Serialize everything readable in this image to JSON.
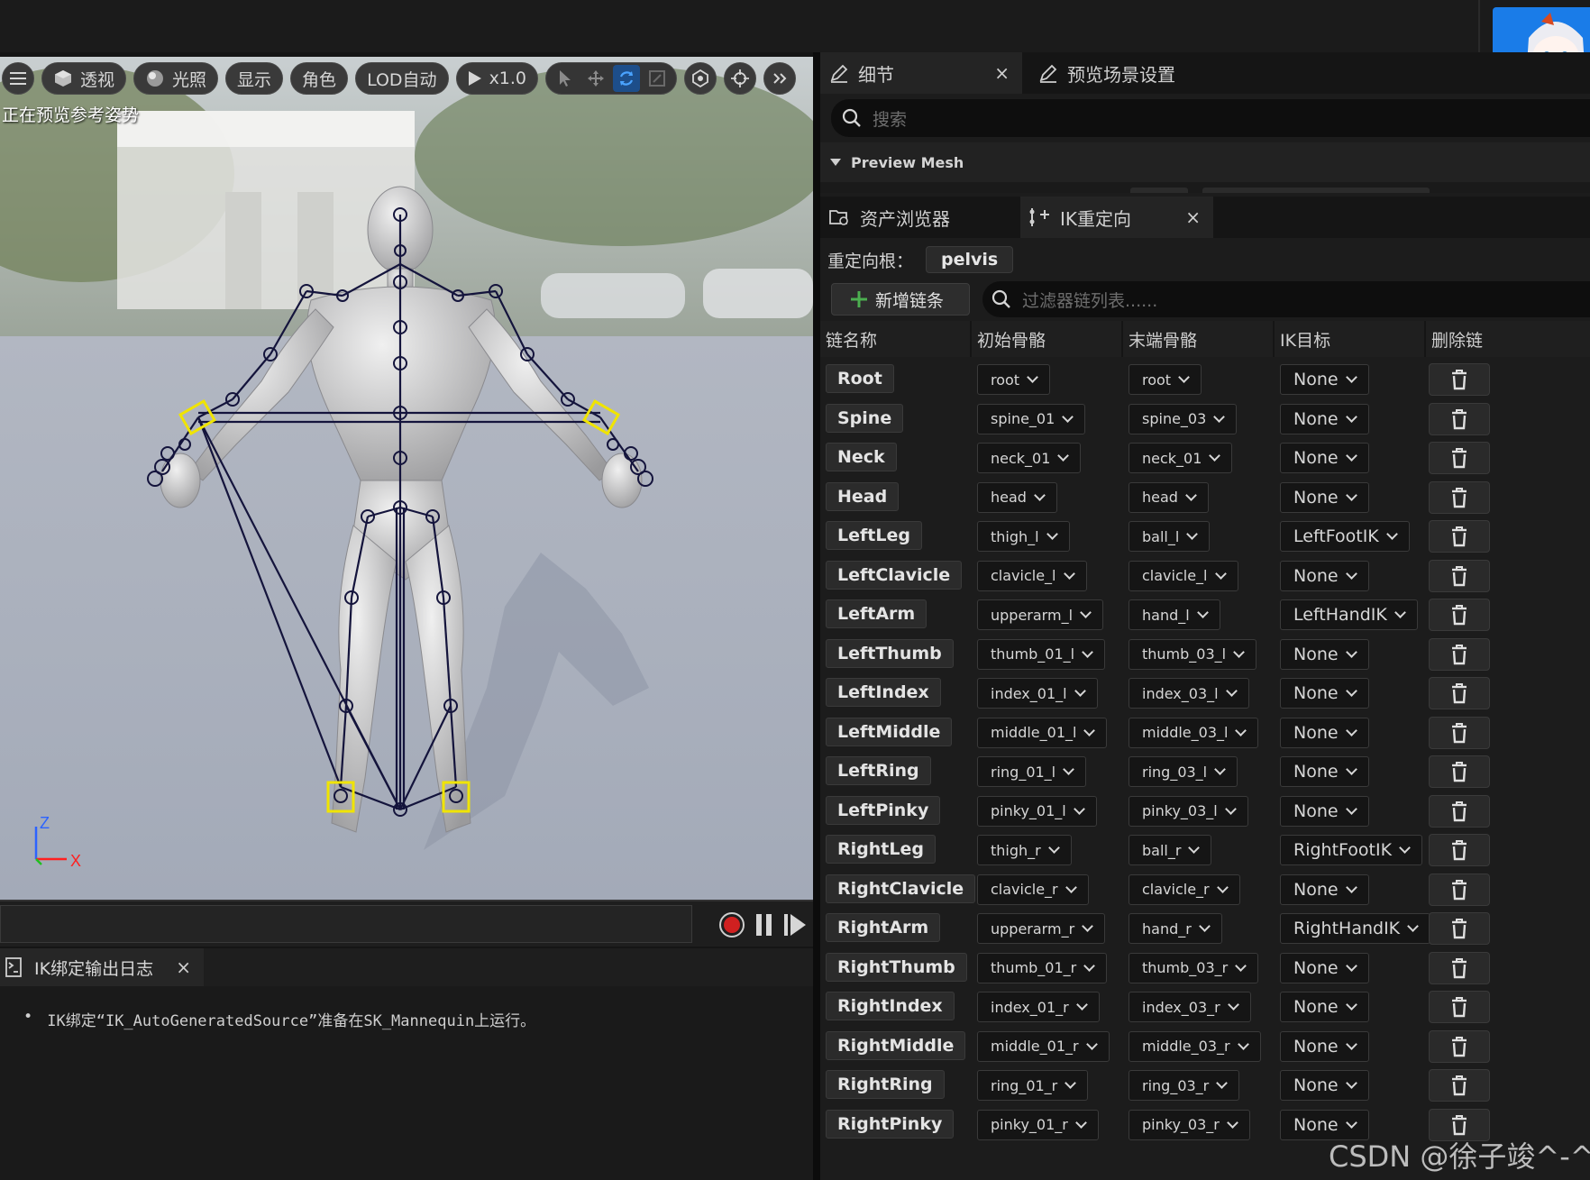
{
  "viewport": {
    "toolbar": {
      "perspective": "透视",
      "lighting": "光照",
      "show": "显示",
      "character": "角色",
      "lod": "LOD自动",
      "speed": "x1.0"
    },
    "status": "正在预览参考姿势",
    "axis": {
      "z": "Z",
      "x": "X"
    }
  },
  "log": {
    "tab_label": "IK绑定输出日志",
    "message": "IK绑定“IK_AutoGeneratedSource”准备在SK_Mannequin上运行。"
  },
  "details": {
    "tab_details": "细节",
    "tab_preview_settings": "预览场景设置",
    "search_placeholder": "搜索",
    "section_preview_mesh": "Preview Mesh"
  },
  "retarget": {
    "tab_asset_browser": "资产浏览器",
    "tab_ik_retarget": "IK重定向",
    "root_label": "重定向根：",
    "root_value": "pelvis",
    "add_chain": "新增链条",
    "filter_placeholder": "过滤器链列表......",
    "columns": {
      "name": "链名称",
      "start": "初始骨骼",
      "end": "末端骨骼",
      "ik": "IK目标",
      "delete": "删除链"
    },
    "chains": [
      {
        "name": "Root",
        "start": "root",
        "end": "root",
        "ik": "None"
      },
      {
        "name": "Spine",
        "start": "spine_01",
        "end": "spine_03",
        "ik": "None"
      },
      {
        "name": "Neck",
        "start": "neck_01",
        "end": "neck_01",
        "ik": "None"
      },
      {
        "name": "Head",
        "start": "head",
        "end": "head",
        "ik": "None"
      },
      {
        "name": "LeftLeg",
        "start": "thigh_l",
        "end": "ball_l",
        "ik": "LeftFootIK"
      },
      {
        "name": "LeftClavicle",
        "start": "clavicle_l",
        "end": "clavicle_l",
        "ik": "None"
      },
      {
        "name": "LeftArm",
        "start": "upperarm_l",
        "end": "hand_l",
        "ik": "LeftHandIK"
      },
      {
        "name": "LeftThumb",
        "start": "thumb_01_l",
        "end": "thumb_03_l",
        "ik": "None"
      },
      {
        "name": "LeftIndex",
        "start": "index_01_l",
        "end": "index_03_l",
        "ik": "None"
      },
      {
        "name": "LeftMiddle",
        "start": "middle_01_l",
        "end": "middle_03_l",
        "ik": "None"
      },
      {
        "name": "LeftRing",
        "start": "ring_01_l",
        "end": "ring_03_l",
        "ik": "None"
      },
      {
        "name": "LeftPinky",
        "start": "pinky_01_l",
        "end": "pinky_03_l",
        "ik": "None"
      },
      {
        "name": "RightLeg",
        "start": "thigh_r",
        "end": "ball_r",
        "ik": "RightFootIK"
      },
      {
        "name": "RightClavicle",
        "start": "clavicle_r",
        "end": "clavicle_r",
        "ik": "None"
      },
      {
        "name": "RightArm",
        "start": "upperarm_r",
        "end": "hand_r",
        "ik": "RightHandIK"
      },
      {
        "name": "RightThumb",
        "start": "thumb_01_r",
        "end": "thumb_03_r",
        "ik": "None"
      },
      {
        "name": "RightIndex",
        "start": "index_01_r",
        "end": "index_03_r",
        "ik": "None"
      },
      {
        "name": "RightMiddle",
        "start": "middle_01_r",
        "end": "middle_03_r",
        "ik": "None"
      },
      {
        "name": "RightRing",
        "start": "ring_01_r",
        "end": "ring_03_r",
        "ik": "None"
      },
      {
        "name": "RightPinky",
        "start": "pinky_01_r",
        "end": "pinky_03_r",
        "ik": "None"
      }
    ]
  },
  "watermark": "CSDN @徐子竣^-^",
  "colors": {
    "accent_blue": "#1a7ce8",
    "add_green": "#4caf50",
    "record_red": "#d02020",
    "bone_navy": "#14143c",
    "ik_goal_yellow": "#f0e400"
  },
  "icons": {
    "menu": "menu-icon",
    "perspective": "cube-icon",
    "lighting": "sphere-icon",
    "play": "play-icon",
    "details": "pencil-icon",
    "search": "search-icon",
    "trash": "trash-icon"
  }
}
